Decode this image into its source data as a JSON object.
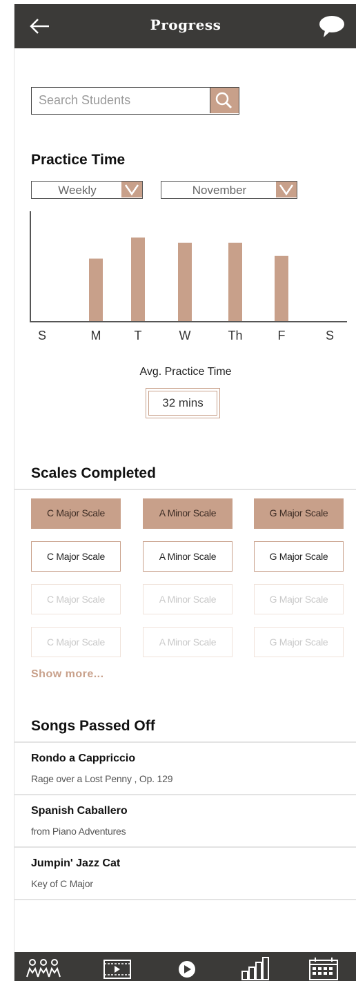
{
  "header": {
    "title": "Progress",
    "back_icon": "arrow-left-icon",
    "chat_icon": "speech-bubble-icon"
  },
  "search": {
    "placeholder": "Search Students",
    "icon": "search-icon"
  },
  "practice": {
    "title": "Practice Time",
    "period_dropdown": "Weekly",
    "month_dropdown": "November",
    "avg_label": "Avg. Practice Time",
    "avg_value": "32 mins"
  },
  "chart_data": {
    "type": "bar",
    "categories": [
      "S",
      "M",
      "T",
      "W",
      "Th",
      "F",
      "S"
    ],
    "values": [
      0,
      24,
      32,
      30,
      30,
      25,
      0
    ],
    "title": "",
    "xlabel": "",
    "ylabel": "",
    "ylim": [
      0,
      42
    ],
    "grid": false,
    "bar_color": "#c8a08a"
  },
  "scales": {
    "title": "Scales Completed",
    "rows": [
      {
        "style": "filled",
        "items": [
          "C Major Scale",
          "A Minor Scale",
          "G Major Scale"
        ]
      },
      {
        "style": "outline",
        "items": [
          "C Major Scale",
          "A Minor Scale",
          "G Major Scale"
        ]
      },
      {
        "style": "faded",
        "items": [
          "C Major Scale",
          "A Minor Scale",
          "G Major Scale"
        ]
      },
      {
        "style": "faded",
        "items": [
          "C Major Scale",
          "A Minor Scale",
          "G Major Scale"
        ]
      }
    ],
    "show_more": "Show more..."
  },
  "songs": {
    "title": "Songs Passed Off",
    "items": [
      {
        "title": "Rondo a Cappriccio",
        "subtitle": "Rage over a Lost Penny , Op. 129"
      },
      {
        "title": "Spanish Caballero",
        "subtitle": "from Piano Adventures"
      },
      {
        "title": "Jumpin' Jazz Cat",
        "subtitle": "Key of C Major"
      }
    ]
  },
  "bottom_nav": {
    "items": [
      "students-icon",
      "video-icon",
      "play-icon",
      "progress-chart-icon",
      "calendar-icon"
    ]
  },
  "colors": {
    "header_bg": "#3b3a38",
    "accent": "#c8a08a",
    "faded_accent": "#f0e2da"
  }
}
